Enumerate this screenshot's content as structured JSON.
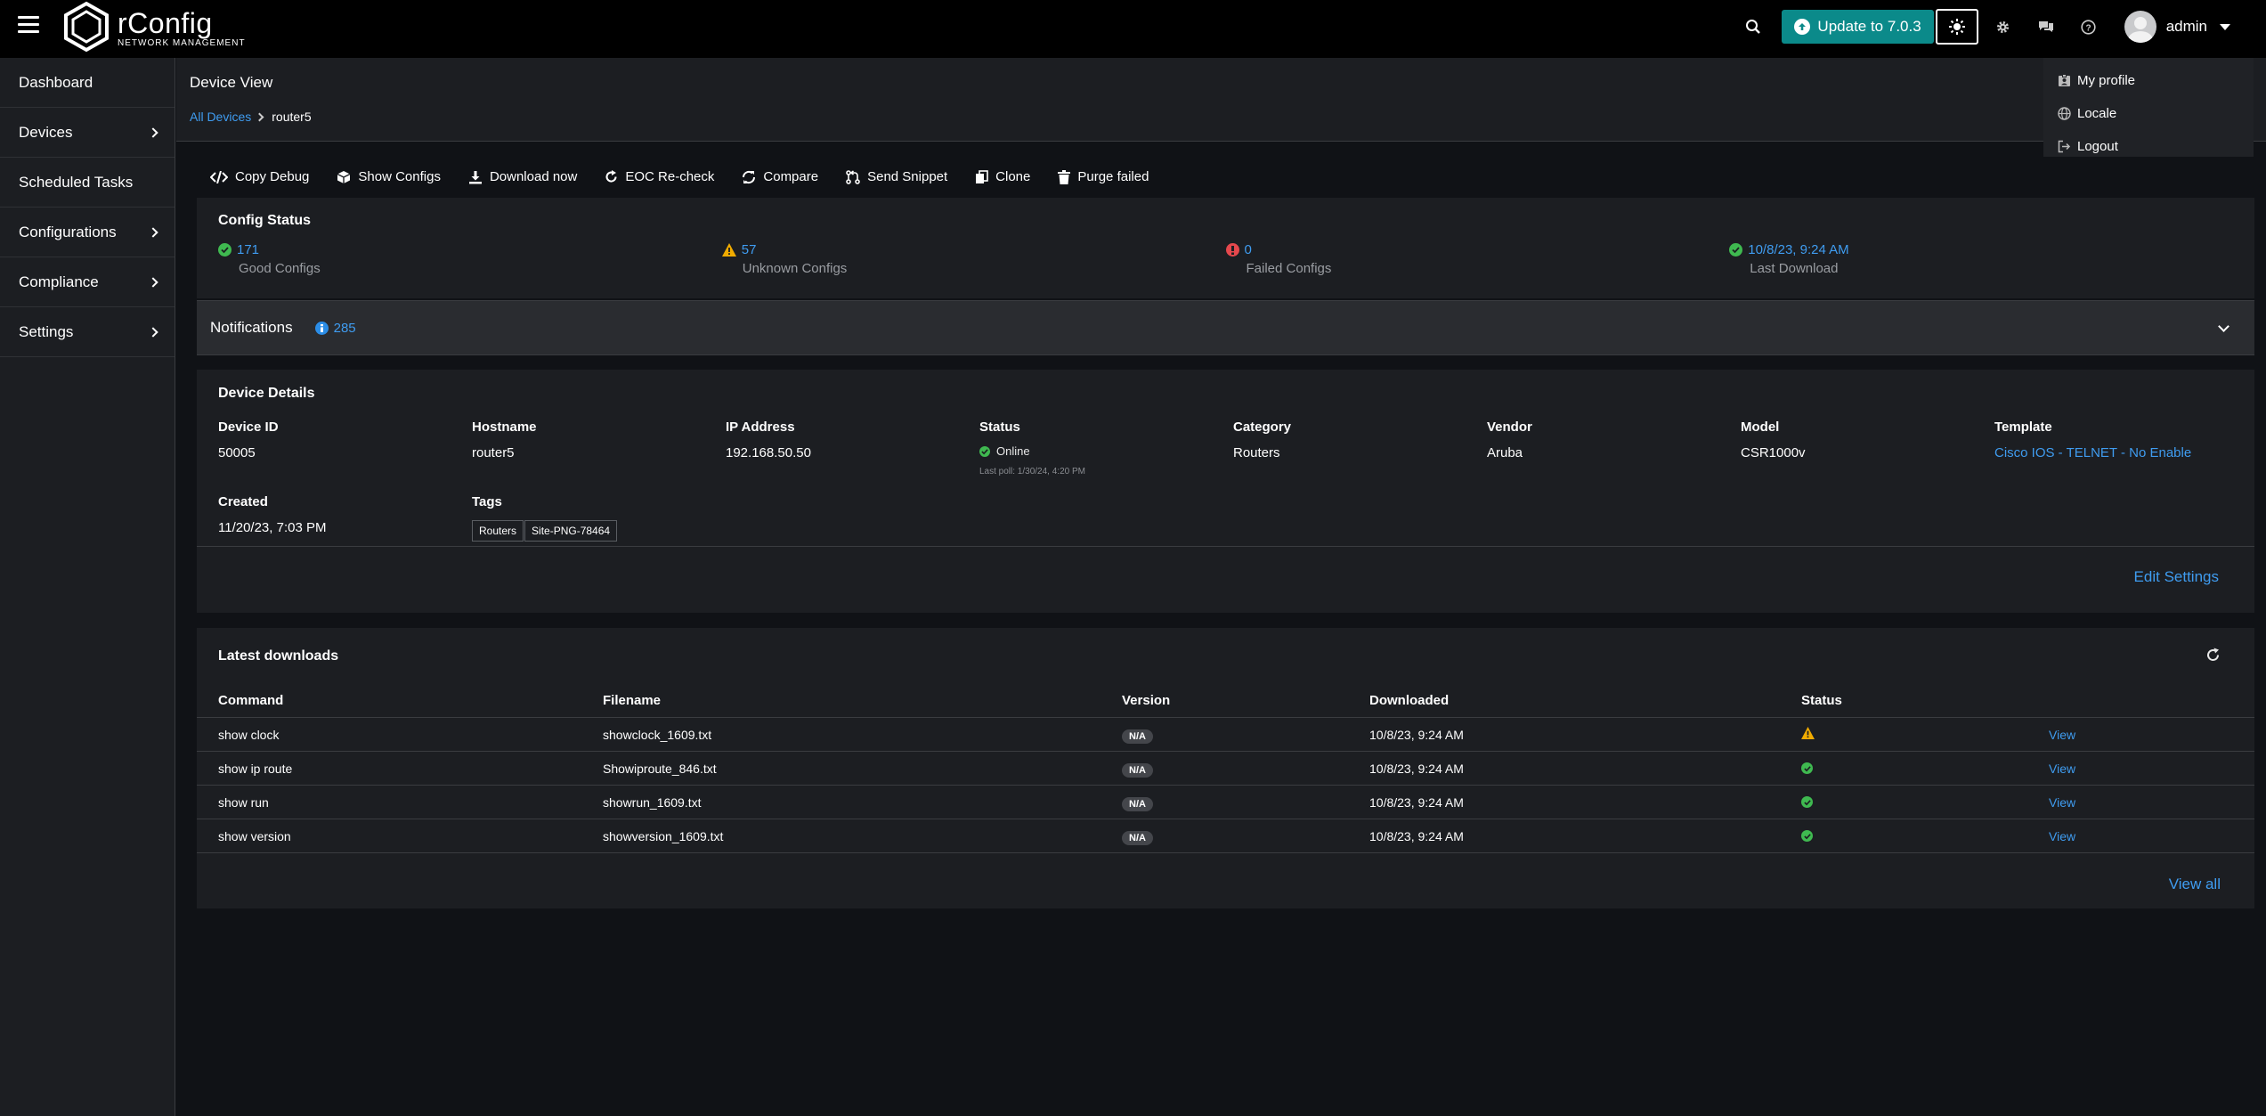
{
  "header": {
    "brand_name": "rConfig",
    "brand_sub": "NETWORK MANAGEMENT",
    "update_label": "Update to 7.0.3",
    "user_name": "admin",
    "colors": {
      "update": "#0b8a8a",
      "link": "#3f9cf0"
    }
  },
  "sidebar": {
    "items": [
      {
        "label": "Dashboard",
        "has_children": false
      },
      {
        "label": "Devices",
        "has_children": true
      },
      {
        "label": "Scheduled Tasks",
        "has_children": false
      },
      {
        "label": "Configurations",
        "has_children": true
      },
      {
        "label": "Compliance",
        "has_children": true
      },
      {
        "label": "Settings",
        "has_children": true
      }
    ]
  },
  "page": {
    "title": "Device View",
    "breadcrumb": {
      "parent": "All Devices",
      "current": "router5"
    }
  },
  "toolbar": {
    "copy_debug": "Copy Debug",
    "show_configs": "Show Configs",
    "download_now": "Download now",
    "eoc_recheck": "EOC Re-check",
    "compare": "Compare",
    "send_snippet": "Send Snippet",
    "clone": "Clone",
    "purge_failed": "Purge failed"
  },
  "config_status": {
    "title": "Config Status",
    "good": {
      "value": "171",
      "label": "Good Configs"
    },
    "unknown": {
      "value": "57",
      "label": "Unknown Configs"
    },
    "failed": {
      "value": "0",
      "label": "Failed Configs"
    },
    "last": {
      "value": "10/8/23, 9:24 AM",
      "label": "Last Download"
    }
  },
  "notifications": {
    "label": "Notifications",
    "count": "285"
  },
  "device_details": {
    "title": "Device Details",
    "device_id": {
      "key": "Device ID",
      "value": "50005"
    },
    "hostname": {
      "key": "Hostname",
      "value": "router5"
    },
    "ip": {
      "key": "IP Address",
      "value": "192.168.50.50"
    },
    "status": {
      "key": "Status",
      "value": "Online",
      "last_poll": "Last poll: 1/30/24, 4:20 PM"
    },
    "category": {
      "key": "Category",
      "value": "Routers"
    },
    "vendor": {
      "key": "Vendor",
      "value": "Aruba"
    },
    "model": {
      "key": "Model",
      "value": "CSR1000v"
    },
    "template": {
      "key": "Template",
      "value": "Cisco IOS - TELNET - No Enable"
    },
    "created": {
      "key": "Created",
      "value": "11/20/23, 7:03 PM"
    },
    "tags": {
      "key": "Tags",
      "items": [
        "Routers",
        "Site-PNG-78464"
      ]
    },
    "edit_settings": "Edit Settings"
  },
  "downloads": {
    "title": "Latest downloads",
    "columns": [
      "Command",
      "Filename",
      "Version",
      "Downloaded",
      "Status"
    ],
    "rows": [
      {
        "command": "show clock",
        "filename": "showclock_1609.txt",
        "version": "N/A",
        "downloaded": "10/8/23, 9:24 AM",
        "status": "warning",
        "action": "View"
      },
      {
        "command": "show ip route",
        "filename": "Showiproute_846.txt",
        "version": "N/A",
        "downloaded": "10/8/23, 9:24 AM",
        "status": "success",
        "action": "View"
      },
      {
        "command": "show run",
        "filename": "showrun_1609.txt",
        "version": "N/A",
        "downloaded": "10/8/23, 9:24 AM",
        "status": "success",
        "action": "View"
      },
      {
        "command": "show version",
        "filename": "showversion_1609.txt",
        "version": "N/A",
        "downloaded": "10/8/23, 9:24 AM",
        "status": "success",
        "action": "View"
      }
    ],
    "view_all": "View all"
  },
  "user_dropdown": {
    "my_profile": "My profile",
    "locale": "Locale",
    "logout": "Logout"
  }
}
